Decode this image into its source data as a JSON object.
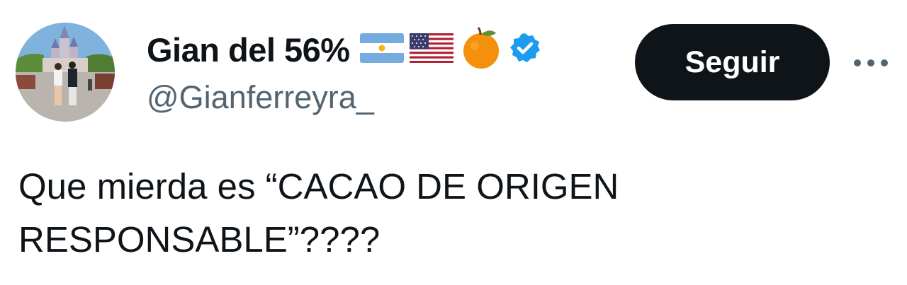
{
  "author": {
    "display_name": "Gian del 56%",
    "handle": "@Gianferreyra_",
    "name_emojis": [
      "argentina-flag-icon",
      "usa-flag-icon",
      "orange-icon",
      "verified-badge-icon"
    ]
  },
  "actions": {
    "follow_label": "Seguir",
    "more_icon": "more-icon"
  },
  "tweet": {
    "lines": [
      "Que mierda es “CACAO DE ORIGEN",
      "RESPONSABLE”????"
    ]
  },
  "colors": {
    "text_primary": "#0f1419",
    "text_secondary": "#536471",
    "follow_button_bg": "#0f1419",
    "verified_blue": "#1d9bf0",
    "orange": "#f4900c"
  }
}
